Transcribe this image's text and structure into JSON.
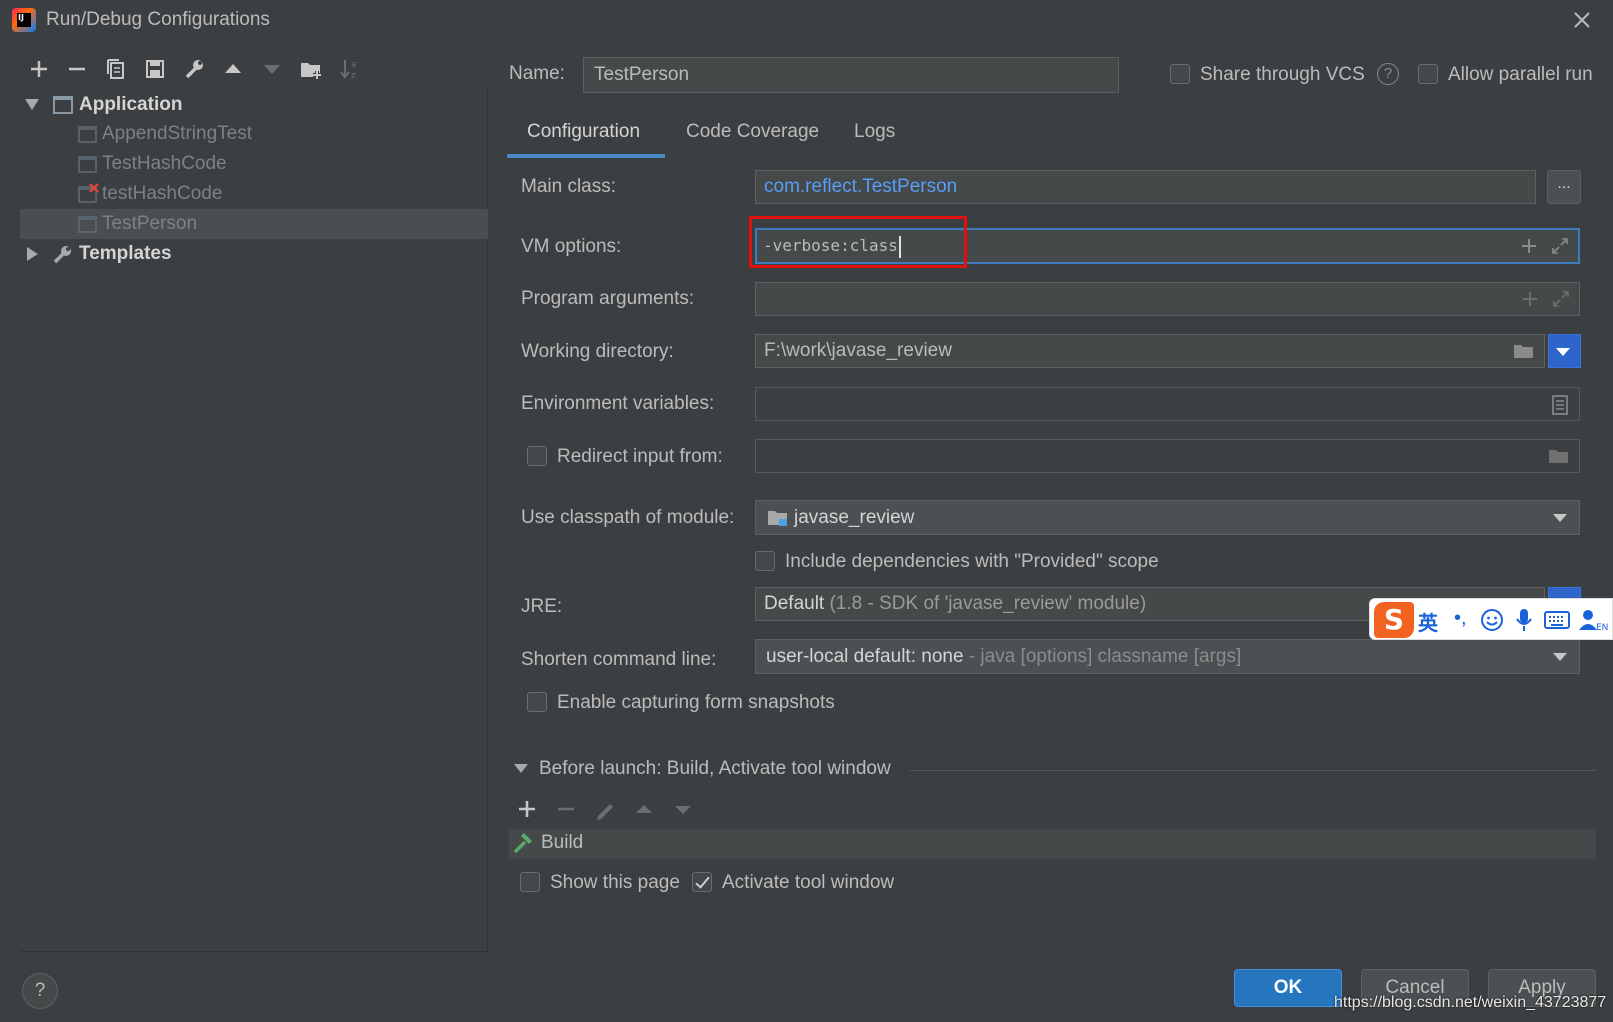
{
  "window": {
    "title": "Run/Debug Configurations"
  },
  "tree": {
    "application": "Application",
    "items": [
      "AppendStringTest",
      "TestHashCode",
      "testHashCode",
      "TestPerson"
    ],
    "templates": "Templates"
  },
  "form": {
    "name_label": "Name:",
    "name_value": "TestPerson",
    "share_vcs": "Share through VCS",
    "allow_parallel": "Allow parallel run",
    "tabs": [
      "Configuration",
      "Code Coverage",
      "Logs"
    ],
    "main_class_label": "Main class:",
    "main_class_value": "com.reflect.TestPerson",
    "browse_label": "...",
    "vm_options_label": "VM options:",
    "vm_options_value": "-verbose:class",
    "program_args_label": "Program arguments:",
    "working_dir_label": "Working directory:",
    "working_dir_value": "F:\\work\\javase_review",
    "env_vars_label": "Environment variables:",
    "redirect_label": "Redirect input from:",
    "classpath_label": "Use classpath of module:",
    "classpath_value": "javase_review",
    "include_deps": "Include dependencies with \"Provided\" scope",
    "jre_label": "JRE:",
    "jre_value_main": "Default",
    "jre_value_detail": "(1.8 - SDK of 'javase_review' module)",
    "shorten_label": "Shorten command line:",
    "shorten_value_main": "user-local default: none",
    "shorten_value_detail": "- java [options] classname [args]",
    "snapshots_label": "Enable capturing form snapshots"
  },
  "before_launch": {
    "header": "Before launch: Build, Activate tool window",
    "build": "Build",
    "show_page": "Show this page",
    "activate": "Activate tool window"
  },
  "buttons": {
    "ok": "OK",
    "cancel": "Cancel",
    "apply": "Apply",
    "help": "?"
  },
  "ime": {
    "logo": "S",
    "lang": "英",
    "punct": "•,"
  },
  "watermark": "https://blog.csdn.net/weixin_43723877",
  "colors": {
    "accent": "#4a88c7",
    "ok_button": "#2675bf",
    "highlight": "#e01010",
    "link": "#589df6"
  }
}
